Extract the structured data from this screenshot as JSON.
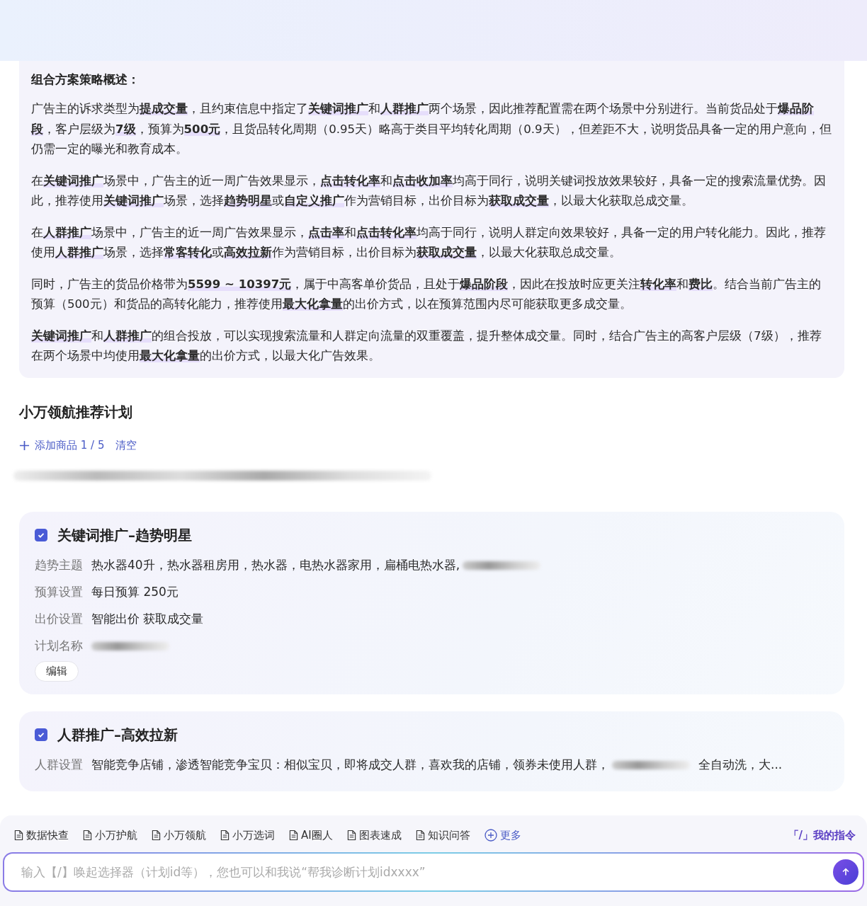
{
  "summary": {
    "title": "组合方案策略概述：",
    "paragraphs": [
      "广告主的诉求类型为**提成交量**，且约束信息中指定了**关键词推广**和**人群推广**两个场景，因此推荐配置需在两个场景中分别进行。当前货品处于**爆品阶段**，客户层级为**7级**，预算为**500元**，且货品转化周期（0.95天）略高于类目平均转化周期（0.9天），但差距不大，说明货品具备一定的用户意向，但仍需一定的曝光和教育成本。",
      "在**关键词推广**场景中，广告主的近一周广告效果显示，**点击转化率**和**点击收加率**均高于同行，说明关键词投放效果较好，具备一定的搜索流量优势。因此，推荐使用**关键词推广**场景，选择**趋势明星**或**自定义推广**作为营销目标，出价目标为**获取成交量**，以最大化获取总成交量。",
      "在**人群推广**场景中，广告主的近一周广告效果显示，**点击率**和**点击转化率**均高于同行，说明人群定向效果较好，具备一定的用户转化能力。因此，推荐使用**人群推广**场景，选择**常客转化**或**高效拉新**作为营销目标，出价目标为**获取成交量**，以最大化获取总成交量。",
      "同时，广告主的货品价格带为**5599 ~ 10397元**，属于中高客单价货品，且处于**爆品阶段**，因此在投放时应更关注**转化率**和**费比**。结合当前广告主的预算（500元）和货品的高转化能力，推荐使用**最大化拿量**的出价方式，以在预算范围内尽可能获取更多成交量。",
      "**关键词推广**和**人群推广**的组合投放，可以实现搜索流量和人群定向流量的双重覆盖，提升整体成交量。同时，结合广告主的高客户层级（7级），推荐在两个场景中均使用**最大化拿量**的出价方式，以最大化广告效果。"
    ]
  },
  "section_title": "小万领航推荐计划",
  "add_product": {
    "label": "添加商品 1 / 5",
    "clear": "清空"
  },
  "plans": [
    {
      "title": "关键词推广–趋势明星",
      "checked": true,
      "fields": [
        {
          "label": "趋势主题",
          "parts": [
            {
              "kind": "text",
              "text": "热水器40升，热水器租房用，热水器，电热水器家用，扁桶电热水器,"
            },
            {
              "kind": "blur"
            }
          ]
        },
        {
          "label": "预算设置",
          "parts": [
            {
              "kind": "text",
              "text": "每日预算 250元"
            }
          ]
        },
        {
          "label": "出价设置",
          "parts": [
            {
              "kind": "text",
              "text": "智能出价 获取成交量"
            }
          ]
        },
        {
          "label": "计划名称",
          "parts": [
            {
              "kind": "blur"
            }
          ]
        }
      ],
      "edit": "编辑"
    },
    {
      "title": "人群推广–高效拉新",
      "checked": true,
      "fields": [
        {
          "label": "人群设置",
          "parts": [
            {
              "kind": "text",
              "text": "智能竞争店铺，渗透智能竞争宝贝：相似宝贝，即将成交人群，喜欢我的店铺，领券未使用人群，"
            },
            {
              "kind": "blur"
            },
            {
              "kind": "text",
              "text": "全自动洗，大..."
            }
          ]
        }
      ]
    }
  ],
  "toolbar": {
    "items": [
      {
        "kind": "doc",
        "label": "数据快查"
      },
      {
        "kind": "doc",
        "label": "小万护航"
      },
      {
        "kind": "doc",
        "label": "小万领航"
      },
      {
        "kind": "doc",
        "label": "小万选词"
      },
      {
        "kind": "doc",
        "label": "AI圈人"
      },
      {
        "kind": "doc",
        "label": "图表速成"
      },
      {
        "kind": "doc",
        "label": "知识问答"
      },
      {
        "kind": "more",
        "label": "更多"
      }
    ],
    "commands": "「/」我的指令"
  },
  "input": {
    "placeholder": "输入【/】唤起选择器（计划id等），您也可以和我说“帮我诊断计划idxxxx”"
  }
}
